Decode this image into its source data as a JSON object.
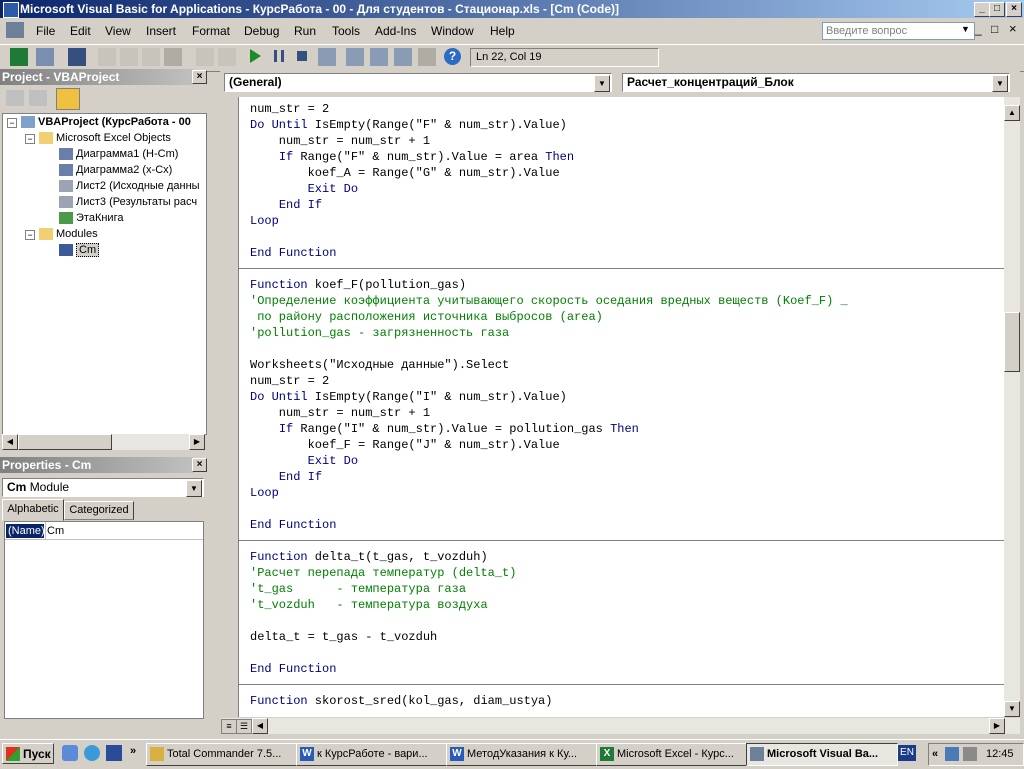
{
  "window": {
    "title": "Microsoft Visual Basic for Applications - КурсРабота - 00 - Для студентов - Стационар.xls - [Cm (Code)]",
    "min": "_",
    "max": "□",
    "close": "×"
  },
  "menu": {
    "items": [
      "File",
      "Edit",
      "View",
      "Insert",
      "Format",
      "Debug",
      "Run",
      "Tools",
      "Add-Ins",
      "Window",
      "Help"
    ],
    "ask_placeholder": "Введите вопрос"
  },
  "toolbar": {
    "position": "Ln 22, Col 19"
  },
  "project": {
    "title": "Project - VBAProject",
    "tree": {
      "root": "VBAProject (КурсРабота - 00",
      "excel_objects": "Microsoft Excel Objects",
      "items": [
        "Диаграмма1 (H-Cm)",
        "Диаграмма2 (x-Cx)",
        "Лист2 (Исходные данны",
        "Лист3 (Результаты расч",
        "ЭтаКнига"
      ],
      "modules": "Modules",
      "module_items": [
        "Cm"
      ]
    }
  },
  "properties": {
    "title": "Properties - Cm",
    "object_bold": "Cm",
    "object_type": "Module",
    "tabs": [
      "Alphabetic",
      "Categorized"
    ],
    "row_name": "(Name)",
    "row_value": "Cm"
  },
  "code": {
    "object_combo": "(General)",
    "proc_combo": "Расчет_концентраций_Блок",
    "lines": [
      {
        "t": "num_str = 2",
        "c": "n"
      },
      {
        "t": "Do Until IsEmpty(Range(\"F\" & num_str).Value)",
        "c": "n"
      },
      {
        "t": "    num_str = num_str + 1",
        "c": "n"
      },
      {
        "t": "    If Range(\"F\" & num_str).Value = area Then",
        "c": "n"
      },
      {
        "t": "        koef_A = Range(\"G\" & num_str).Value",
        "c": "n"
      },
      {
        "t": "        Exit Do",
        "c": "k"
      },
      {
        "t": "    End If",
        "c": "k"
      },
      {
        "t": "Loop",
        "c": "k"
      },
      {
        "t": "",
        "c": "n"
      },
      {
        "t": "End Function",
        "c": "k"
      },
      {
        "t": "",
        "c": "sep"
      },
      {
        "t": "Function koef_F(pollution_gas)",
        "c": "n"
      },
      {
        "t": "'Определение коэффициента учитывающего скорость оседания вредных веществ (Koef_F) _",
        "c": "c"
      },
      {
        "t": " по району расположения источника выбросов (area)",
        "c": "c"
      },
      {
        "t": "'pollution_gas - загрязненность газа",
        "c": "c"
      },
      {
        "t": "",
        "c": "n"
      },
      {
        "t": "Worksheets(\"Исходные данные\").Select",
        "c": "n"
      },
      {
        "t": "num_str = 2",
        "c": "n"
      },
      {
        "t": "Do Until IsEmpty(Range(\"I\" & num_str).Value)",
        "c": "n"
      },
      {
        "t": "    num_str = num_str + 1",
        "c": "n"
      },
      {
        "t": "    If Range(\"I\" & num_str).Value = pollution_gas Then",
        "c": "n"
      },
      {
        "t": "        koef_F = Range(\"J\" & num_str).Value",
        "c": "n"
      },
      {
        "t": "        Exit Do",
        "c": "k"
      },
      {
        "t": "    End If",
        "c": "k"
      },
      {
        "t": "Loop",
        "c": "k"
      },
      {
        "t": "",
        "c": "n"
      },
      {
        "t": "End Function",
        "c": "k"
      },
      {
        "t": "",
        "c": "sep"
      },
      {
        "t": "Function delta_t(t_gas, t_vozduh)",
        "c": "n"
      },
      {
        "t": "'Расчет перепада температур (delta_t)",
        "c": "c"
      },
      {
        "t": "'t_gas      - температура газа",
        "c": "c"
      },
      {
        "t": "'t_vozduh   - температура воздуха",
        "c": "c"
      },
      {
        "t": "",
        "c": "n"
      },
      {
        "t": "delta_t = t_gas - t_vozduh",
        "c": "n"
      },
      {
        "t": "",
        "c": "n"
      },
      {
        "t": "End Function",
        "c": "k"
      },
      {
        "t": "",
        "c": "sep"
      },
      {
        "t": "Function skorost_sred(kol_gas, diam_ustya)",
        "c": "n"
      }
    ]
  },
  "taskbar": {
    "start": "Пуск",
    "tasks": [
      "Total Commander 7.5...",
      "к КурсРаботе - вари...",
      "МетодУказания к Ку...",
      "Microsoft Excel - Курс...",
      "Microsoft Visual Ba..."
    ],
    "lang": "EN",
    "chevron": "«",
    "clock": "12:45"
  }
}
